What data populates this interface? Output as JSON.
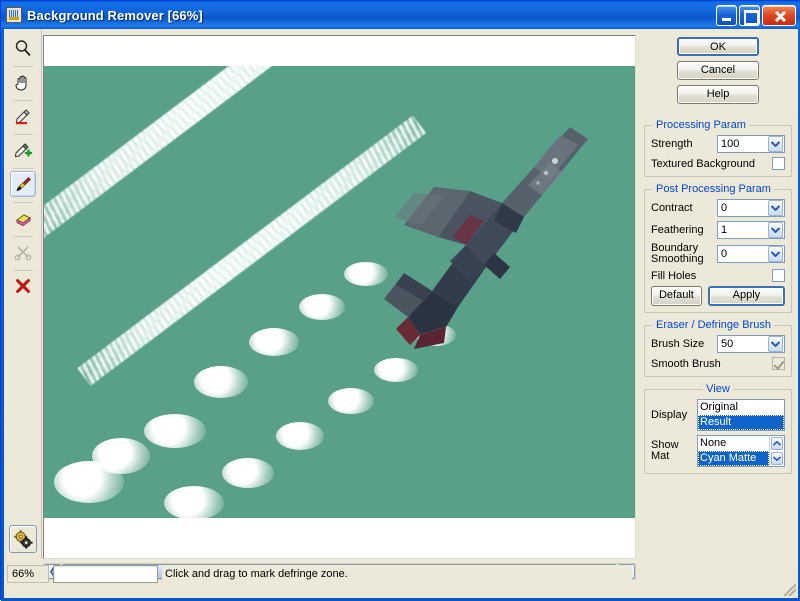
{
  "window": {
    "title": "Background Remover [66%]",
    "icon": "app-icon",
    "buttons": {
      "minimize": "Minimize",
      "maximize": "Maximize",
      "close": "Close"
    }
  },
  "toolbar": {
    "tools": [
      {
        "name": "zoom-tool",
        "icon": "magnifier-icon",
        "selected": false,
        "enabled": true
      },
      {
        "name": "pan-tool",
        "icon": "hand-icon",
        "selected": false,
        "enabled": true
      },
      {
        "name": "mark-background-tool",
        "icon": "marker-red-icon",
        "selected": false,
        "enabled": true
      },
      {
        "name": "mark-foreground-tool",
        "icon": "marker-green-plus-icon",
        "selected": false,
        "enabled": true
      },
      {
        "name": "defringe-brush-tool",
        "icon": "brush-icon",
        "selected": true,
        "enabled": true
      },
      {
        "name": "eraser-tool",
        "icon": "eraser-icon",
        "selected": false,
        "enabled": true
      },
      {
        "name": "cut-tool",
        "icon": "scissors-icon",
        "selected": false,
        "enabled": false
      },
      {
        "name": "delete-tool",
        "icon": "red-x-icon",
        "selected": false,
        "enabled": true
      }
    ],
    "settings_button": {
      "name": "settings-button",
      "icon": "gears-icon"
    }
  },
  "actions": {
    "ok": "OK",
    "cancel": "Cancel",
    "help": "Help"
  },
  "processing_param": {
    "legend": "Processing Param",
    "strength_label": "Strength",
    "strength_value": "100",
    "textured_background_label": "Textured Background",
    "textured_background_checked": false
  },
  "post_processing_param": {
    "legend": "Post Processing Param",
    "contract_label": "Contract",
    "contract_value": "0",
    "feathering_label": "Feathering",
    "feathering_value": "1",
    "boundary_smoothing_label_line1": "Boundary",
    "boundary_smoothing_label_line2": "Smoothing",
    "boundary_smoothing_value": "0",
    "fill_holes_label": "Fill Holes",
    "fill_holes_checked": false,
    "default_button": "Default",
    "apply_button": "Apply"
  },
  "eraser_defringe": {
    "legend": "Eraser / Defringe  Brush",
    "brush_size_label": "Brush Size",
    "brush_size_value": "50",
    "smooth_brush_label": "Smooth Brush",
    "smooth_brush_checked": true,
    "smooth_brush_enabled": false
  },
  "view": {
    "legend": "View",
    "display_label": "Display",
    "display_options": [
      "Original",
      "Result"
    ],
    "display_selected": "Result",
    "show_mat_label_line1": "Show",
    "show_mat_label_line2": "Mat",
    "show_mat_options": [
      "None",
      "Cyan Matte"
    ],
    "show_mat_selected": "Cyan Matte"
  },
  "canvas": {
    "matte_color": "#58a088",
    "background_color": "#ffffff",
    "subject": "fighter-jet-with-smoke-trails"
  },
  "statusbar": {
    "zoom": "66%",
    "progress": "",
    "hint": "Click and drag to mark defringe zone."
  },
  "scrollbar": {
    "left_arrow": "❮",
    "right_arrow": "❯"
  },
  "colors": {
    "title_blue": "#0a5fd4",
    "group_legend": "#0046d5",
    "selection_blue": "#1063c8",
    "panel_face": "#ece9d8",
    "matte": "#58a088"
  }
}
